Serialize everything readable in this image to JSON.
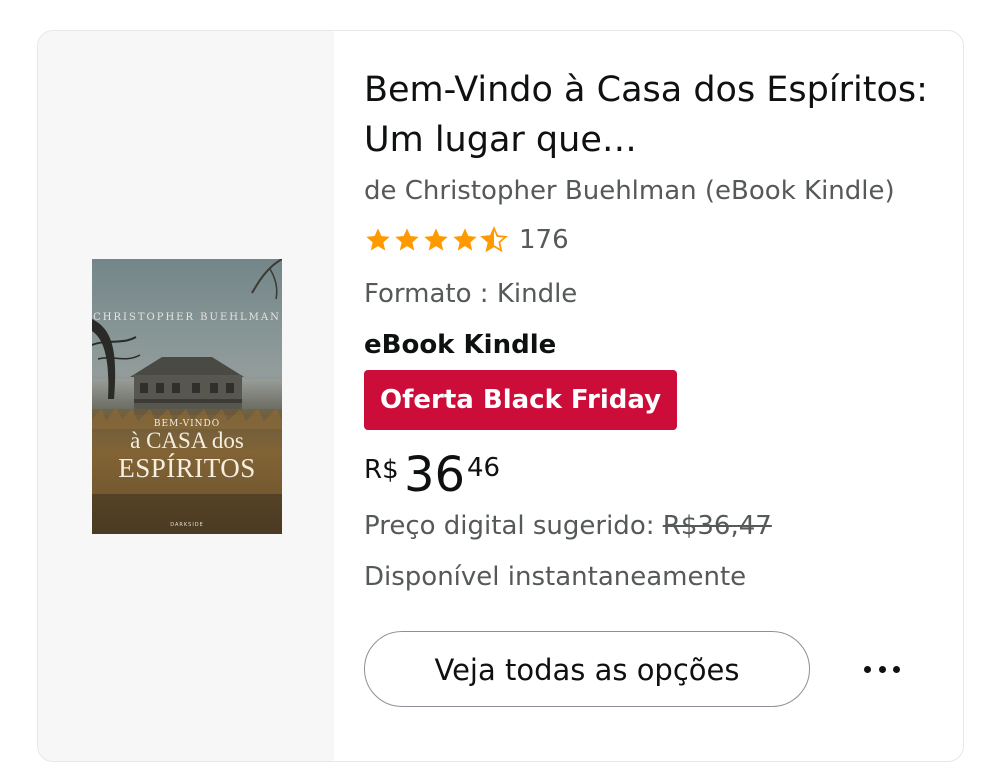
{
  "product": {
    "title": "Bem-Vindo à Casa dos Espíritos: Um lugar que…",
    "byline": "de Christopher Buehlman (eBook Kindle)",
    "rating": {
      "stars": 4.5,
      "max_stars": 5,
      "count": "176",
      "star_color": "#ff9900"
    },
    "format_line": "Formato : Kindle",
    "edition": "eBook Kindle",
    "deal_badge": {
      "label": "Oferta Black Friday",
      "color": "#cc0c39"
    },
    "price": {
      "symbol": "R$",
      "whole": "36",
      "fraction": "46"
    },
    "suggested_price": {
      "label": "Preço digital sugerido:",
      "value": "R$36,47"
    },
    "availability": "Disponível instantaneamente",
    "options_button_label": "Veja todas as opções",
    "more_icon": "more-horizontal-icon"
  },
  "cover": {
    "author": "CHRISTOPHER BUEHLMAN",
    "bem_vindo": "BEM-VINDO",
    "casa": "à CASA dos",
    "espiritos": "ESPÍRITOS",
    "publisher": "DARKSIDE"
  }
}
